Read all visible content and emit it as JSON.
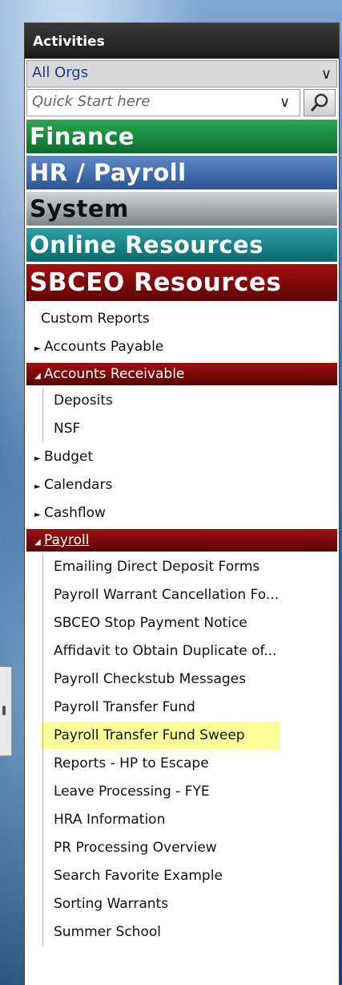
{
  "panel": {
    "title": "Activities",
    "org_select": "All Orgs",
    "quick_start_placeholder": "Quick Start here"
  },
  "categories": {
    "finance": "Finance",
    "hr": "HR / Payroll",
    "system": "System",
    "online": "Online Resources",
    "sbceo": "SBCEO Resources"
  },
  "tree": {
    "custom_reports": "Custom Reports",
    "accounts_payable": "Accounts Payable",
    "accounts_receivable": "Accounts Receivable",
    "ar_children": [
      "Deposits",
      "NSF"
    ],
    "budget": "Budget",
    "calendars": "Calendars",
    "cashflow": "Cashflow",
    "payroll": "Payroll",
    "payroll_children": [
      "Emailing Direct Deposit Forms",
      "Payroll Warrant Cancellation Fo...",
      "SBCEO Stop Payment Notice",
      "Affidavit to Obtain Duplicate of...",
      "Payroll Checkstub Messages",
      "Payroll Transfer Fund",
      "Payroll Transfer Fund Sweep",
      "Reports - HP to Escape",
      "Leave Processing - FYE",
      "HRA Information",
      "PR Processing Overview",
      "Search Favorite Example",
      "Sorting Warrants",
      "Summer School"
    ]
  },
  "colors": {
    "highlight": "#ffff99",
    "selected": "#7a0a0b",
    "finance": "#0b6e2b",
    "hr": "#2b5596",
    "online": "#056a70"
  },
  "icons": {
    "dropdown": "chevron-down-icon",
    "search": "magnifier-icon",
    "collapsed": "triangle-right-icon",
    "expanded": "triangle-down-icon"
  }
}
